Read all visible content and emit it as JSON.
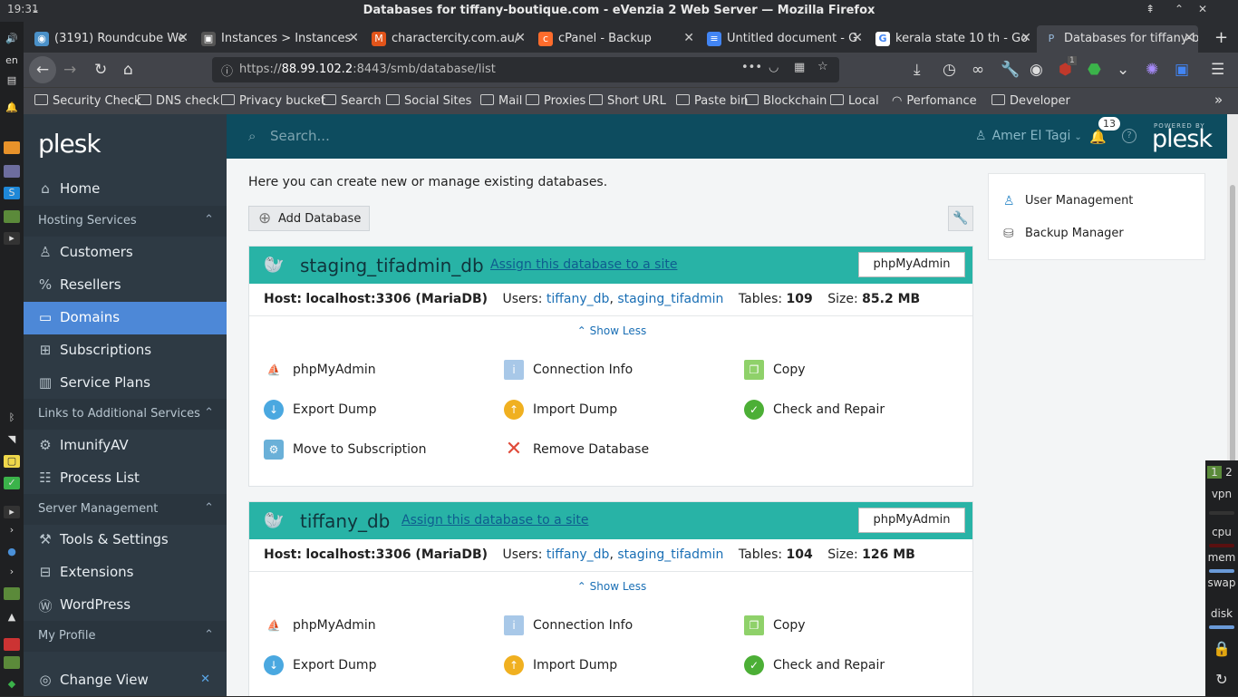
{
  "window": {
    "title": "Databases for tiffany-boutique.com - eVenzia 2 Web Server — Mozilla Firefox",
    "clock": "19:31"
  },
  "dock": {
    "lang": "en"
  },
  "tabs": [
    {
      "label": "(3191) Roundcube We",
      "icon": "roundcube-icon",
      "color": "#4a90c8"
    },
    {
      "label": "Instances > Instances",
      "icon": "instances-icon",
      "color": "#555"
    },
    {
      "label": "charactercity.com.au/",
      "icon": "magento-icon",
      "color": "#e2541a"
    },
    {
      "label": "cPanel - Backup",
      "icon": "cpanel-icon",
      "color": "#ff6c2c"
    },
    {
      "label": "Untitled document - G",
      "icon": "docs-icon",
      "color": "#4285f4"
    },
    {
      "label": "kerala state 10 th - Go",
      "icon": "google-icon",
      "color": "#fff"
    },
    {
      "label": "Databases for tiffany-b",
      "icon": "plesk-icon",
      "color": "#4d88d7"
    }
  ],
  "address": {
    "prefix": "https://",
    "host": "88.99.102.2",
    "rest": ":8443/smb/database/list"
  },
  "bookmarks": [
    "Security Check",
    "DNS check",
    "Privacy bucket",
    "Search",
    "Social Sites",
    "Mail",
    "Proxies",
    "Short URL",
    "Paste bin",
    "Blockchain",
    "Local",
    "Perfomance",
    "Developer"
  ],
  "toolbar": {
    "ublock_count": "1"
  },
  "sidebar": {
    "logo": "plesk",
    "home": "Home",
    "sections": {
      "hosting": "Hosting Services",
      "links": "Links to Additional Services",
      "server": "Server Management",
      "profile": "My Profile"
    },
    "items": {
      "customers": "Customers",
      "resellers": "Resellers",
      "domains": "Domains",
      "subscriptions": "Subscriptions",
      "plans": "Service Plans",
      "imunify": "ImunifyAV",
      "process": "Process List",
      "tools": "Tools & Settings",
      "extensions": "Extensions",
      "wordpress": "WordPress",
      "changeview": "Change View"
    }
  },
  "header": {
    "search_placeholder": "Search...",
    "user": "Amer El Tagi",
    "notifications": "13",
    "powered": "POWERED BY",
    "brand": "plesk"
  },
  "main": {
    "intro": "Here you can create new or manage existing databases.",
    "add_label": "Add Database",
    "databases": [
      {
        "name": "staging_tifadmin_db",
        "assign": "Assign this database to a site",
        "pma": "phpMyAdmin",
        "host": "localhost:3306 (MariaDB)",
        "users": [
          "tiffany_db",
          "staging_tifadmin"
        ],
        "tables": "109",
        "size": "85.2 MB"
      },
      {
        "name": "tiffany_db",
        "assign": "Assign this database to a site",
        "pma": "phpMyAdmin",
        "host": "localhost:3306 (MariaDB)",
        "users": [
          "tiffany_db",
          "staging_tifadmin"
        ],
        "tables": "104",
        "size": "126 MB"
      }
    ],
    "labels": {
      "host": "Host:",
      "users": "Users:",
      "tables": "Tables:",
      "size": "Size:",
      "show_less": "Show Less",
      "comma": ","
    },
    "actions": {
      "phpmyadmin": "phpMyAdmin",
      "connection": "Connection Info",
      "copy": "Copy",
      "export": "Export Dump",
      "import": "Import Dump",
      "check": "Check and Repair",
      "move": "Move to Subscription",
      "remove": "Remove Database"
    }
  },
  "right_panel": {
    "user_management": "User Management",
    "backup_manager": "Backup Manager"
  },
  "tray": {
    "ws1": "1",
    "ws2": "2",
    "vpn": "vpn",
    "cpu": "cpu",
    "mem": "mem",
    "swap": "swap",
    "disk": "disk"
  }
}
